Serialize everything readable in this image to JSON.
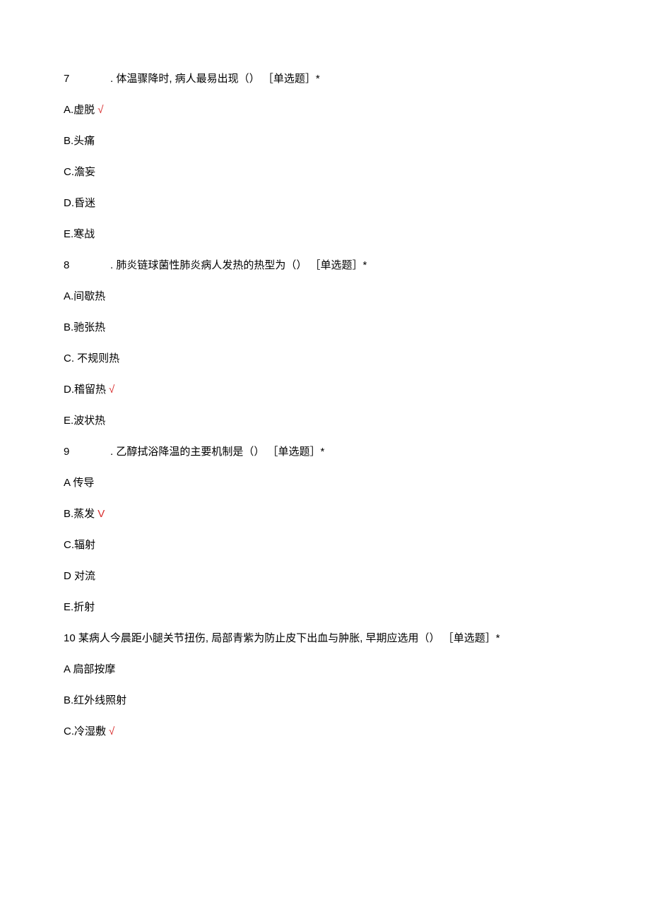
{
  "questions": [
    {
      "number": "7",
      "text": ". 体温骤降时, 病人最易出现（） ［单选题］*",
      "options": [
        {
          "label": "A.虚脱",
          "correct": true
        },
        {
          "label": "B.头痛",
          "correct": false
        },
        {
          "label": "C.澹妄",
          "correct": false
        },
        {
          "label": "D.昏迷",
          "correct": false
        },
        {
          "label": "E.寒战",
          "correct": false
        }
      ]
    },
    {
      "number": "8",
      "text": ". 肺炎链球菌性肺炎病人发热的热型为（） ［单选题］*",
      "options": [
        {
          "label": "A.间歇热",
          "correct": false
        },
        {
          "label": "B.驰张热",
          "correct": false
        },
        {
          "label": "C. 不规则热",
          "correct": false
        },
        {
          "label": "D.稽留热",
          "correct": true
        },
        {
          "label": "E.波状热",
          "correct": false
        }
      ]
    },
    {
      "number": "9",
      "text": ". 乙醇拭浴降温的主要机制是（） ［单选题］*",
      "options": [
        {
          "label": "A 传导",
          "correct": false
        },
        {
          "label": "B.蒸发",
          "correct": true,
          "mark": "V"
        },
        {
          "label": "C.辐射",
          "correct": false
        },
        {
          "label": "D 对流",
          "correct": false
        },
        {
          "label": "E.折射",
          "correct": false
        }
      ]
    },
    {
      "number": "10",
      "text": " 某病人今晨距小腿关节扭伤, 局部青紫为防止皮下出血与肿胀, 早期应选用（） ［单选题］*",
      "inline": true,
      "options": [
        {
          "label": "A 扃部按摩",
          "correct": false
        },
        {
          "label": "B.红外线照射",
          "correct": false
        },
        {
          "label": "C.冷湿敷",
          "correct": true
        }
      ]
    }
  ],
  "marks": {
    "check": "√"
  }
}
